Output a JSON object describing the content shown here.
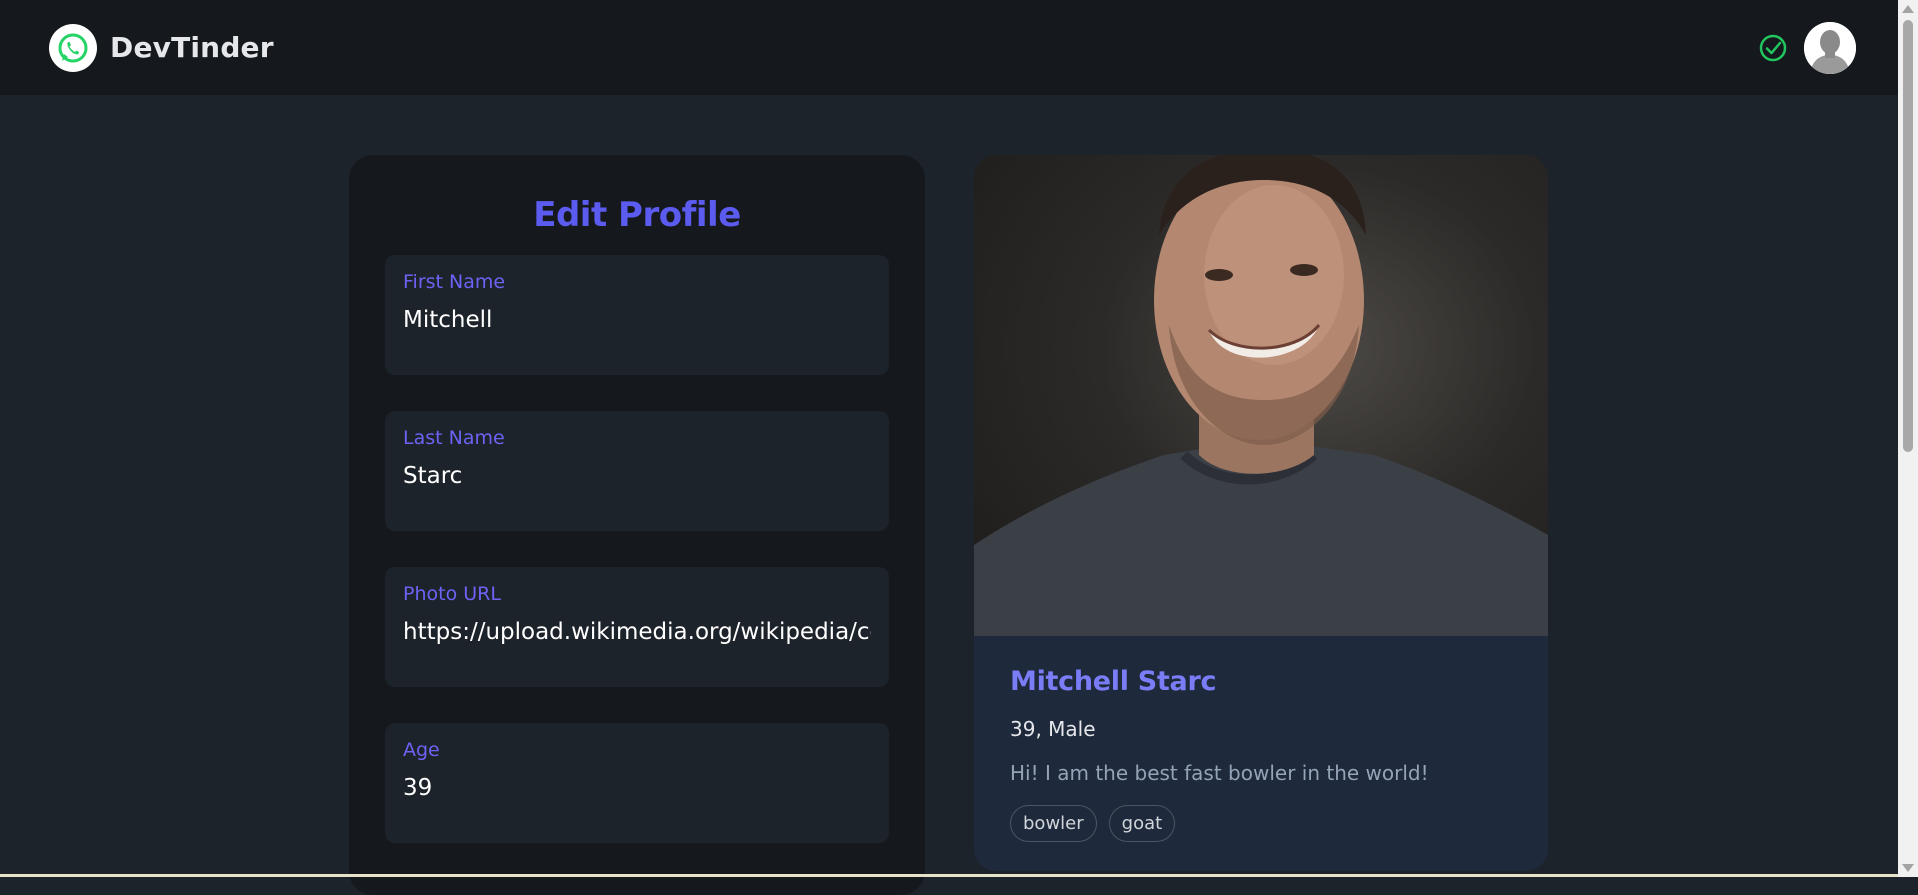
{
  "navbar": {
    "brand_name": "DevTinder",
    "logo_icon": "whatsapp-icon",
    "status_icon": "check-circle-icon",
    "avatar_icon": "user-avatar-icon"
  },
  "edit_profile": {
    "title": "Edit Profile",
    "fields": [
      {
        "label": "First Name",
        "value": "Mitchell"
      },
      {
        "label": "Last Name",
        "value": "Starc"
      },
      {
        "label": "Photo URL",
        "value": "https://upload.wikimedia.org/wikipedia/com"
      },
      {
        "label": "Age",
        "value": "39"
      }
    ]
  },
  "preview": {
    "name": "Mitchell Starc",
    "meta": "39, Male",
    "about": "Hi! I am the best fast bowler in the world!",
    "skills": [
      "bowler",
      "goat"
    ]
  },
  "colors": {
    "accent": "#5b5bf0",
    "success": "#22c55e",
    "background": "#1d232a",
    "navbar": "#15191e"
  }
}
